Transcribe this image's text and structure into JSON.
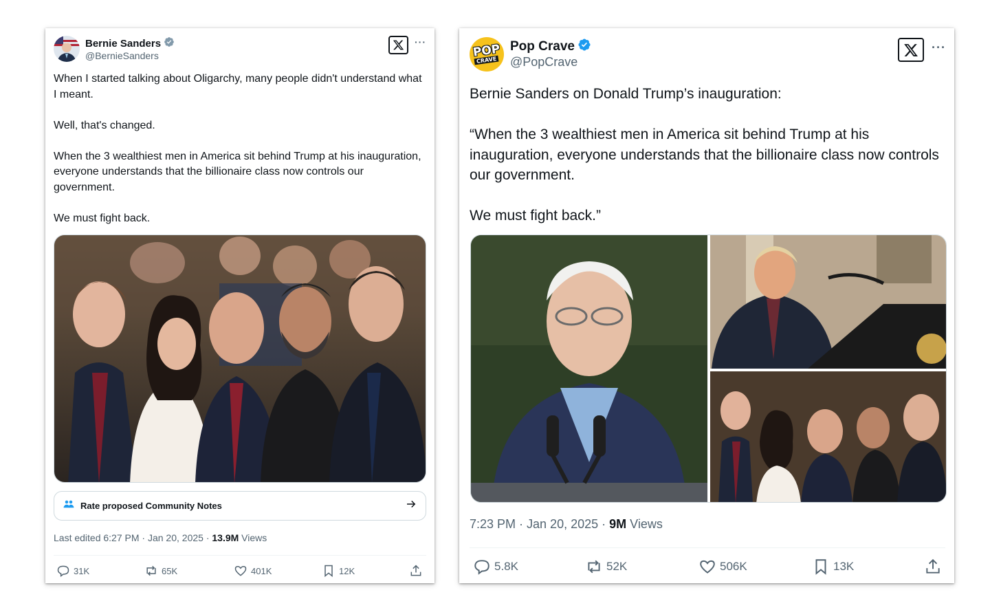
{
  "left_tweet": {
    "author_name": "Bernie Sanders",
    "author_handle": "@BernieSanders",
    "text": "When I started talking about Oligarchy, many people didn't understand what I meant.\n\nWell, that's changed.\n\nWhen the 3 wealthiest men in America sit behind Trump at his inauguration, everyone understands that the billionaire class now controls our government.\n\nWe must fight back.",
    "community_notes_label": "Rate proposed Community Notes",
    "meta_prefix": "Last edited 6:27 PM · Jan 20, 2025 · ",
    "views_count": "13.9M",
    "views_label": " Views",
    "actions": {
      "replies": "31K",
      "reposts": "65K",
      "likes": "401K",
      "bookmarks": "12K"
    }
  },
  "right_tweet": {
    "author_name": "Pop Crave",
    "author_handle": "@PopCrave",
    "avatar_text_top": "POP",
    "avatar_text_bottom": "CRAVE",
    "text": "Bernie Sanders on Donald Trump’s inauguration:\n\n“When the 3 wealthiest men in America sit behind Trump at his inauguration, everyone understands that the billionaire class now controls our government.\n\nWe must fight back.”",
    "meta_prefix": "7:23 PM · Jan 20, 2025 · ",
    "views_count": "9M",
    "views_label": " Views",
    "actions": {
      "replies": "5.8K",
      "reposts": "52K",
      "likes": "506K",
      "bookmarks": "13K"
    }
  },
  "colors": {
    "verified": "#1d9bf0",
    "muted": "#536471",
    "text": "#0f1419",
    "popcrave_yellow": "#f6c21c",
    "popcrave_orange": "#f2701f"
  },
  "icons": [
    "verified-badge-icon",
    "x-logo-icon",
    "more-icon",
    "community-notes-icon",
    "arrow-right-icon",
    "reply-icon",
    "repost-icon",
    "like-icon",
    "bookmark-icon",
    "share-icon"
  ]
}
